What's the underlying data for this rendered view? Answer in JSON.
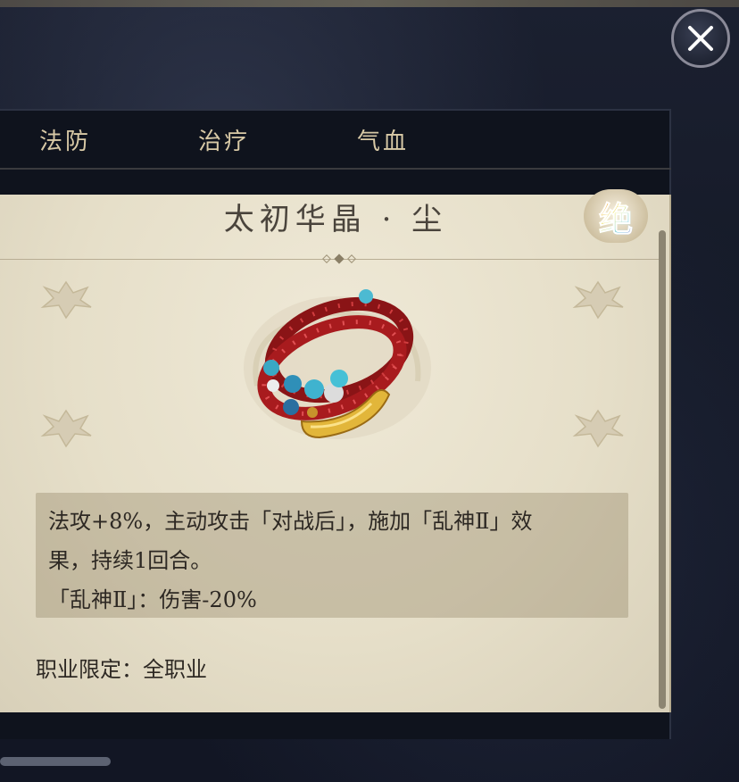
{
  "tabs": [
    {
      "label": "法防"
    },
    {
      "label": "治疗"
    },
    {
      "label": "气血"
    }
  ],
  "item": {
    "name": "太初华晶 · 尘",
    "grade": "绝",
    "description_lines": [
      "法攻+8%，主动攻击「对战后」，施加「乱神Ⅱ」效",
      "果，持续1回合。",
      "「乱神Ⅱ」：伤害-20%"
    ],
    "restriction": "职业限定：全职业"
  },
  "icons": {
    "close": "close-icon",
    "item": "prayer-beads-bracelet-icon"
  },
  "colors": {
    "tab_text": "#d8c9a6",
    "card_bg": "#e6dfc9",
    "text_dark": "#2d2823",
    "desc_bg": "#bfb396"
  }
}
